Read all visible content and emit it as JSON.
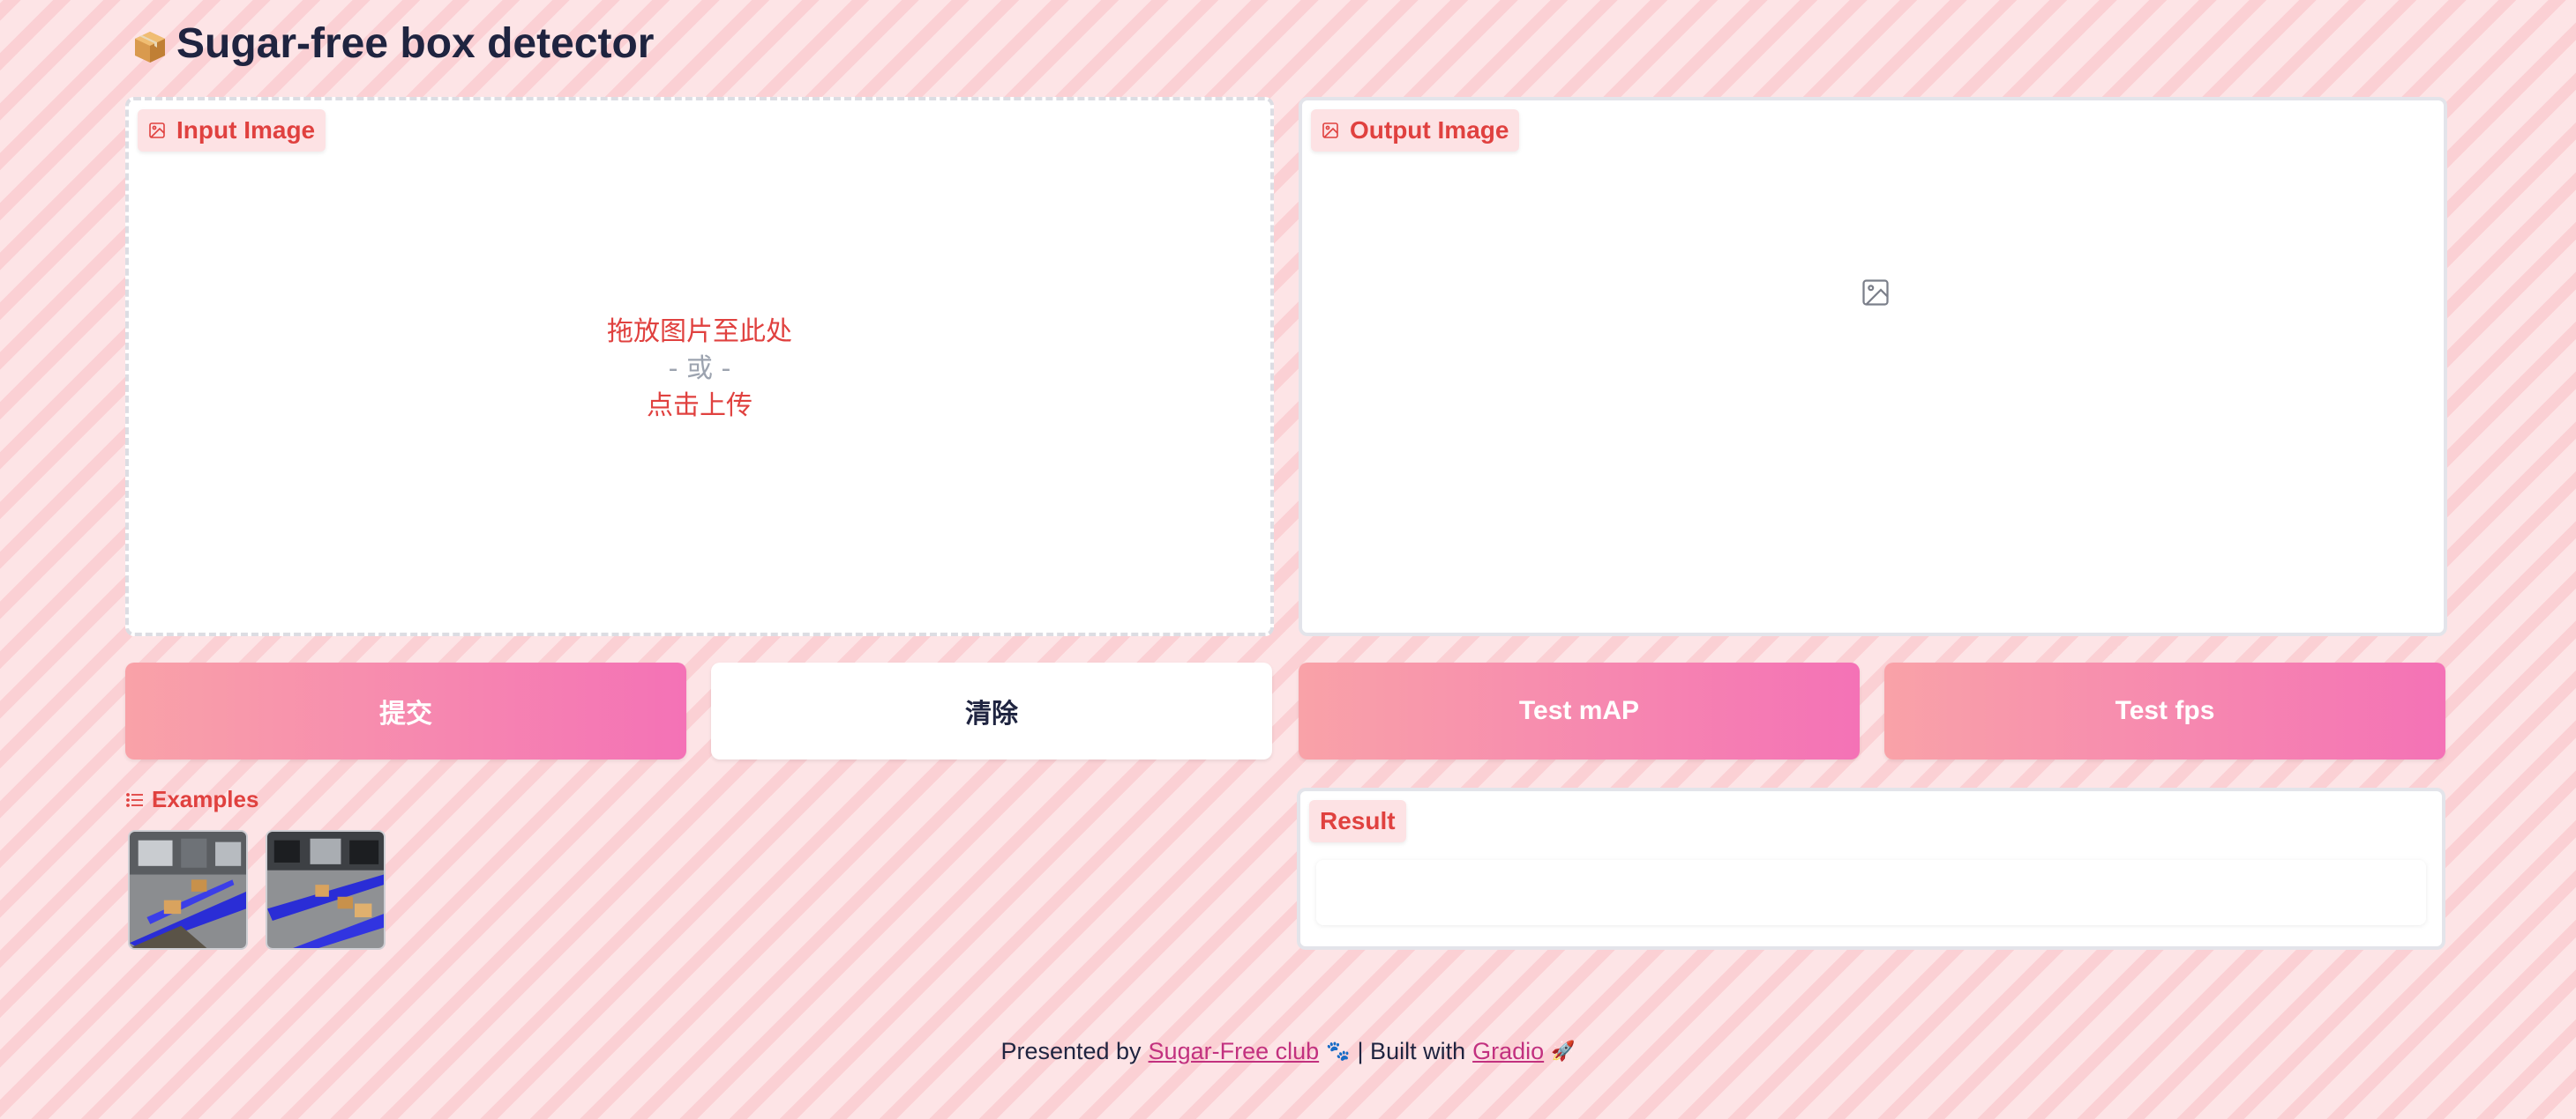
{
  "app": {
    "title": "Sugar-free box detector",
    "title_icon": "package-icon"
  },
  "input_panel": {
    "label": "Input Image",
    "drop_text": "拖放图片至此处",
    "or_text": "- 或 -",
    "click_text": "点击上传"
  },
  "output_panel": {
    "label": "Output Image",
    "placeholder_icon": "image-icon"
  },
  "buttons": {
    "submit": "提交",
    "clear": "清除",
    "test_map": "Test mAP",
    "test_fps": "Test fps"
  },
  "examples": {
    "label": "Examples",
    "items": [
      "example-1",
      "example-2"
    ]
  },
  "result": {
    "label": "Result",
    "value": ""
  },
  "footer": {
    "presented_by": "Presented by",
    "club_link": "Sugar-Free club",
    "separator": "| Built with",
    "gradio_link": "Gradio"
  },
  "colors": {
    "accent": "#e0413f",
    "button_gradient_start": "#f9a2a8",
    "button_gradient_end": "#f472b6",
    "link": "#c2317f"
  }
}
